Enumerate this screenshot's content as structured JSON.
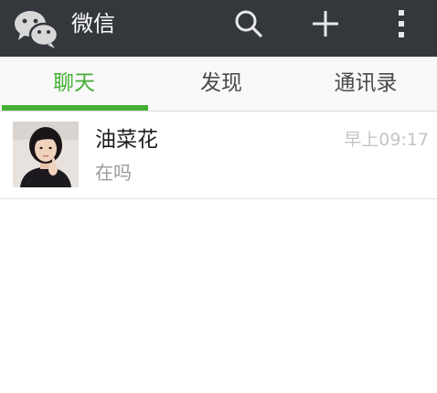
{
  "app_bar": {
    "title": "微信",
    "logo_icon": "wechat-logo-icon",
    "actions": [
      {
        "name": "search",
        "icon": "search-icon"
      },
      {
        "name": "add",
        "icon": "plus-icon"
      },
      {
        "name": "more",
        "icon": "more-vertical-icon"
      }
    ],
    "background_color": "#34383d"
  },
  "tabs": [
    {
      "label": "聊天",
      "active": true
    },
    {
      "label": "发现",
      "active": false
    },
    {
      "label": "通讯录",
      "active": false
    }
  ],
  "accent_color": "#45b035",
  "chats": [
    {
      "name": "油菜花",
      "preview": "在吗",
      "time": "早上09:17",
      "avatar_icon": "contact-photo-avatar"
    }
  ]
}
